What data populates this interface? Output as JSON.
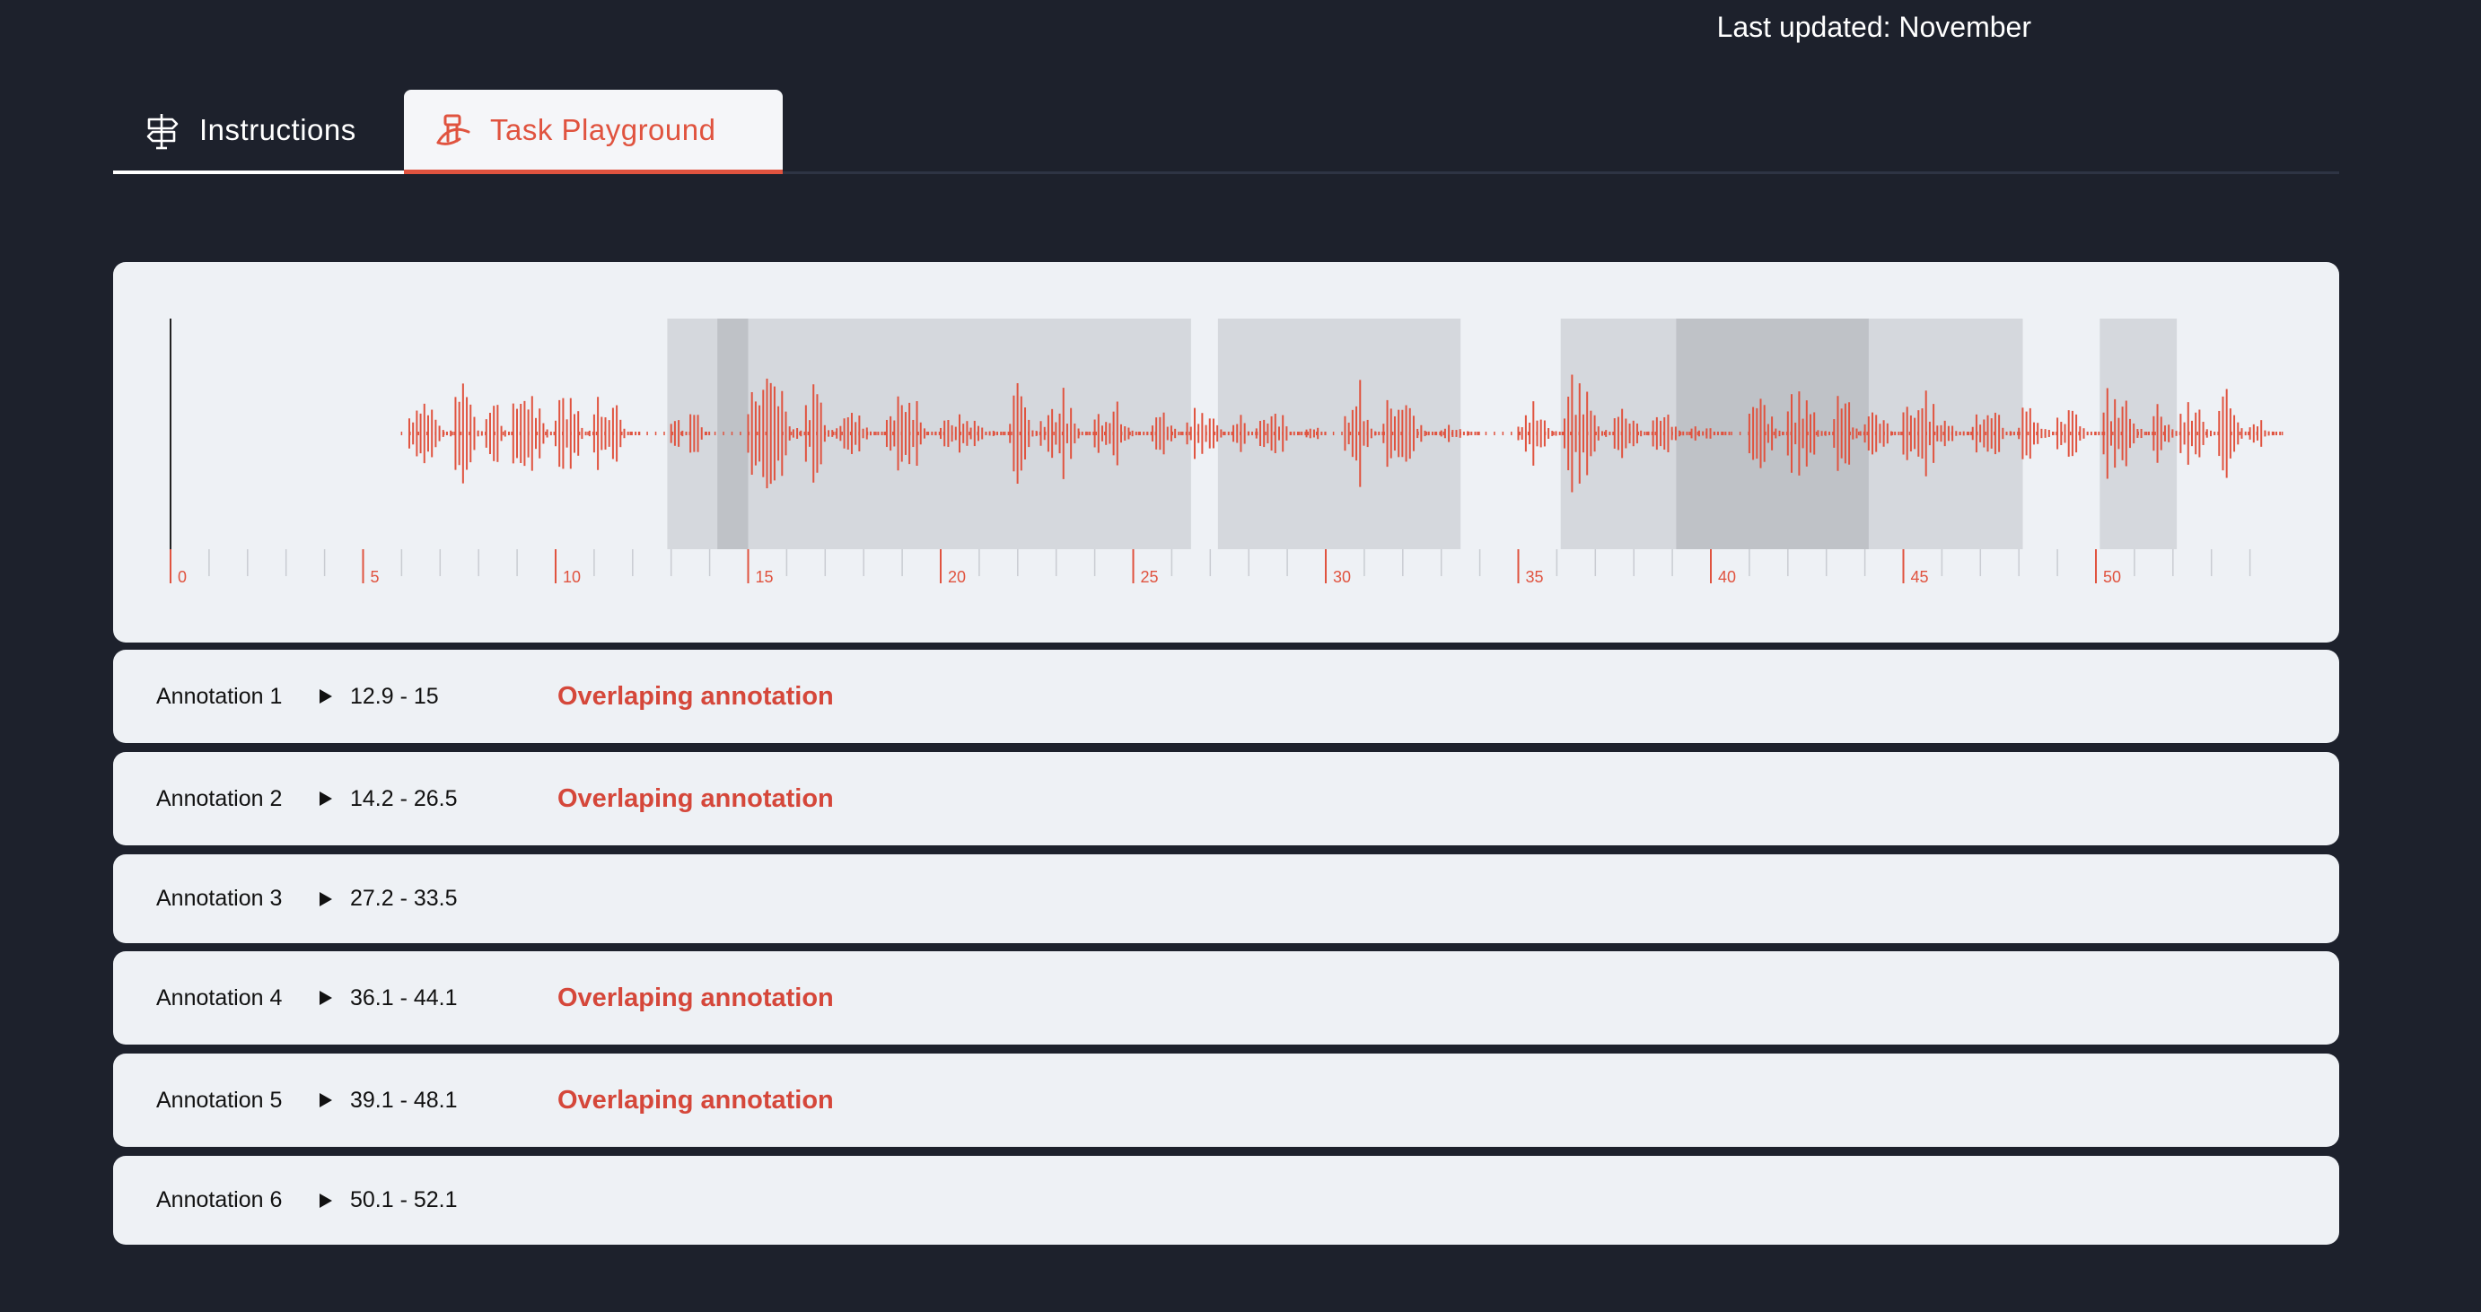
{
  "header": {
    "last_updated": "Last updated: November"
  },
  "tabs": [
    {
      "label": "Instructions",
      "icon": "signpost-icon",
      "active": false
    },
    {
      "label": "Task Playground",
      "icon": "playground-icon",
      "active": true
    }
  ],
  "colors": {
    "background": "#1d212c",
    "accent": "#e0533f",
    "panel": "#eef1f5",
    "region": "#d5d8dd",
    "region_overlap": "#bfc2c7",
    "warning": "#d5473a"
  },
  "waveform": {
    "duration_max": 55,
    "cursor_time": 0,
    "tick_labels": [
      "0",
      "5",
      "10",
      "15",
      "20",
      "25",
      "30",
      "35",
      "40",
      "45",
      "50"
    ],
    "bursts": [
      [
        6.2,
        7.4,
        0.55
      ],
      [
        7.4,
        8.2,
        0.85
      ],
      [
        8.2,
        8.9,
        0.5
      ],
      [
        8.9,
        10.0,
        0.7
      ],
      [
        10.0,
        11.0,
        0.7
      ],
      [
        11.0,
        12.2,
        0.55
      ],
      [
        13.0,
        13.5,
        0.3
      ],
      [
        13.5,
        14.0,
        0.55
      ],
      [
        15.0,
        16.6,
        0.75
      ],
      [
        16.5,
        17.3,
        0.7
      ],
      [
        17.3,
        18.6,
        0.3
      ],
      [
        18.6,
        20.0,
        0.55
      ],
      [
        20.0,
        21.8,
        0.25
      ],
      [
        21.8,
        22.6,
        0.75
      ],
      [
        22.6,
        24.0,
        0.45
      ],
      [
        24.0,
        25.5,
        0.45
      ],
      [
        25.5,
        26.4,
        0.3
      ],
      [
        26.4,
        27.6,
        0.45
      ],
      [
        27.6,
        28.2,
        0.35
      ],
      [
        28.2,
        29.5,
        0.3
      ],
      [
        29.5,
        30.0,
        0.2
      ],
      [
        30.5,
        31.5,
        0.5
      ],
      [
        31.5,
        33.0,
        0.45
      ],
      [
        33.0,
        34.0,
        0.15
      ],
      [
        35.0,
        36.2,
        0.35
      ],
      [
        36.2,
        37.5,
        0.75
      ],
      [
        37.5,
        38.5,
        0.4
      ],
      [
        38.5,
        39.5,
        0.3
      ],
      [
        39.5,
        40.5,
        0.1
      ],
      [
        41.0,
        42.0,
        0.5
      ],
      [
        42.0,
        43.2,
        0.55
      ],
      [
        43.2,
        44.0,
        0.75
      ],
      [
        44.0,
        45.0,
        0.3
      ],
      [
        45.0,
        46.8,
        0.5
      ],
      [
        46.8,
        48.0,
        0.35
      ],
      [
        48.0,
        49.0,
        0.5
      ],
      [
        49.0,
        50.2,
        0.3
      ],
      [
        50.2,
        51.5,
        0.55
      ],
      [
        51.5,
        52.2,
        0.45
      ],
      [
        52.2,
        53.2,
        0.45
      ],
      [
        53.2,
        54.0,
        0.6
      ],
      [
        54.0,
        54.8,
        0.2
      ]
    ]
  },
  "annotations": [
    {
      "label": "Annotation 1",
      "range": "12.9 - 15",
      "start": 12.9,
      "end": 15,
      "warning": "Overlaping annotation"
    },
    {
      "label": "Annotation 2",
      "range": "14.2 - 26.5",
      "start": 14.2,
      "end": 26.5,
      "warning": "Overlaping annotation"
    },
    {
      "label": "Annotation 3",
      "range": "27.2 - 33.5",
      "start": 27.2,
      "end": 33.5,
      "warning": ""
    },
    {
      "label": "Annotation 4",
      "range": "36.1 - 44.1",
      "start": 36.1,
      "end": 44.1,
      "warning": "Overlaping annotation"
    },
    {
      "label": "Annotation 5",
      "range": "39.1 - 48.1",
      "start": 39.1,
      "end": 48.1,
      "warning": "Overlaping annotation"
    },
    {
      "label": "Annotation 6",
      "range": "50.1 - 52.1",
      "start": 50.1,
      "end": 52.1,
      "warning": ""
    }
  ]
}
